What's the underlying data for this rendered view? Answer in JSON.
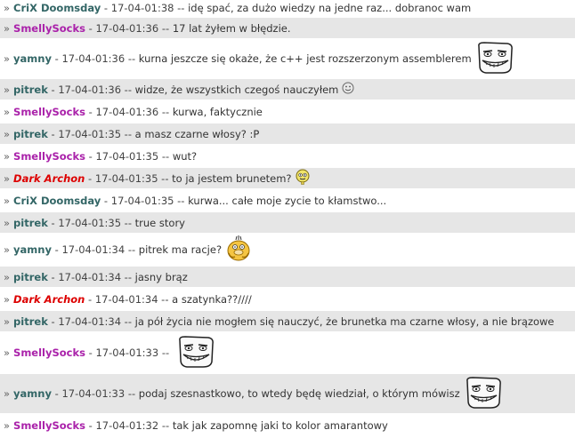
{
  "colors": {
    "crix": "#336666",
    "smelly": "#aa22aa",
    "yamny": "#336666",
    "pitrek": "#336666",
    "dark": "#dd0000",
    "row_alt": "#e6e6e6"
  },
  "messages": [
    {
      "bullet": "»",
      "user": "CriX Doomsday",
      "color": "crix",
      "time": "17-04-01:38",
      "text": "idę spać, za dużo wiedzy na jedne raz... dobranoc wam",
      "emote": "",
      "height": 20,
      "alt": false
    },
    {
      "bullet": "»",
      "user": "SmellySocks",
      "color": "smelly",
      "time": "17-04-01:36",
      "text": "17 lat żyłem w błędzie.",
      "emote": "",
      "height": 25,
      "alt": true
    },
    {
      "bullet": "»",
      "user": "yamny",
      "color": "yamny",
      "time": "17-04-01:36",
      "text": "kurna jeszcze się okaże, że c++ jest rozszerzonym assemblerem",
      "emote": "troll-face",
      "height": 44,
      "alt": false
    },
    {
      "bullet": "»",
      "user": "pitrek",
      "color": "pitrek",
      "time": "17-04-01:36",
      "text": "widze, że wszystkich czegoś nauczyłem",
      "emote": "grin-small",
      "height": 25,
      "alt": true
    },
    {
      "bullet": "»",
      "user": "SmellySocks",
      "color": "smelly",
      "time": "17-04-01:36",
      "text": "kurwa, faktycznie",
      "emote": "",
      "height": 25,
      "alt": false
    },
    {
      "bullet": "»",
      "user": "pitrek",
      "color": "pitrek",
      "time": "17-04-01:35",
      "text": "a masz czarne włosy? :P",
      "emote": "",
      "height": 25,
      "alt": true
    },
    {
      "bullet": "»",
      "user": "SmellySocks",
      "color": "smelly",
      "time": "17-04-01:35",
      "text": "wut?",
      "emote": "",
      "height": 25,
      "alt": false
    },
    {
      "bullet": "»",
      "user": "Dark Archon",
      "color": "dark",
      "time": "17-04-01:35",
      "text": "to ja jestem brunetem?",
      "emote": "confused-face",
      "height": 25,
      "alt": true,
      "italic": true
    },
    {
      "bullet": "»",
      "user": "CriX Doomsday",
      "color": "crix",
      "time": "17-04-01:35",
      "text": "kurwa... całe moje zycie to kłamstwo...",
      "emote": "",
      "height": 25,
      "alt": false
    },
    {
      "bullet": "»",
      "user": "pitrek",
      "color": "pitrek",
      "time": "17-04-01:35",
      "text": "true story",
      "emote": "",
      "height": 25,
      "alt": true
    },
    {
      "bullet": "»",
      "user": "yamny",
      "color": "yamny",
      "time": "17-04-01:34",
      "text": "pitrek ma racje?",
      "emote": "psyduck",
      "height": 36,
      "alt": false
    },
    {
      "bullet": "»",
      "user": "pitrek",
      "color": "pitrek",
      "time": "17-04-01:34",
      "text": "jasny brąz",
      "emote": "",
      "height": 25,
      "alt": true
    },
    {
      "bullet": "»",
      "user": "Dark Archon",
      "color": "dark",
      "time": "17-04-01:34",
      "text": "a szatynka??////",
      "emote": "",
      "height": 25,
      "alt": false,
      "italic": true
    },
    {
      "bullet": "»",
      "user": "pitrek",
      "color": "pitrek",
      "time": "17-04-01:34",
      "text": "ja pół życia nie mogłem się nauczyć, że brunetka ma czarne włosy, a nie brązowe",
      "emote": "",
      "height": 25,
      "alt": true
    },
    {
      "bullet": "»",
      "user": "SmellySocks",
      "color": "smelly",
      "time": "17-04-01:33",
      "text": "",
      "emote": "troll-face",
      "height": 46,
      "alt": false
    },
    {
      "bullet": "»",
      "user": "yamny",
      "color": "yamny",
      "time": "17-04-01:33",
      "text": "podaj szesnastkowo, to wtedy będę wiedział, o którym mówisz",
      "emote": "troll-face",
      "height": 46,
      "alt": true
    },
    {
      "bullet": "»",
      "user": "SmellySocks",
      "color": "smelly",
      "time": "17-04-01:32",
      "text": "tak jak zapomnę jaki to kolor amarantowy",
      "emote": "",
      "height": 25,
      "alt": false
    }
  ]
}
